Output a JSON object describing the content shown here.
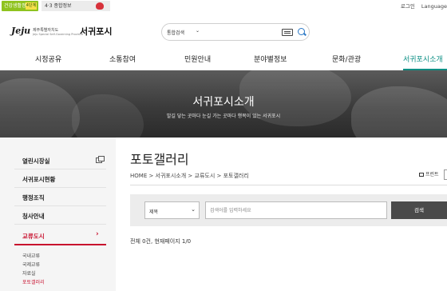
{
  "topbar": {
    "badge1": "건강생활정보",
    "badge1_tag": "4단계",
    "badge2": "4·3 종합정보",
    "links": [
      "로그인",
      "Language"
    ]
  },
  "header": {
    "logo_mark": "Jeju",
    "logo_sub1": "제주특별자치도",
    "logo_sub2": "Jeju Special Self-Governing Province",
    "logo_city": "서귀포시",
    "search": {
      "scope": "통합검색",
      "placeholder": ""
    }
  },
  "gnb": [
    "시정공유",
    "소통참여",
    "민원안내",
    "분야별정보",
    "문화/관광",
    "서귀포시소개"
  ],
  "hero": {
    "title": "서귀포시소개",
    "subtitle": "발길 닿는 곳마다 눈길 가는 곳마다 행복이 있는 서귀포시"
  },
  "lnb": {
    "items": [
      "열린시장실",
      "서귀포시현황",
      "행정조직",
      "청사안내",
      "교류도시"
    ],
    "sub_items": [
      "국내교류",
      "국제교류",
      "자료실",
      "포토갤러리"
    ]
  },
  "content": {
    "title": "포토갤러리",
    "breadcrumb": "HOME > 서귀포시소개 > 교류도시 > 포토갤러리",
    "print": "프린트",
    "filter": {
      "select": "제목",
      "placeholder": "검색어를 입력하세요",
      "button": "검색"
    },
    "result": "전체 0건, 현재페이지 1/0"
  },
  "colors": {
    "accent": "#0b8f84",
    "active_red": "#c8102e",
    "green_badge": "#8fc31f"
  }
}
